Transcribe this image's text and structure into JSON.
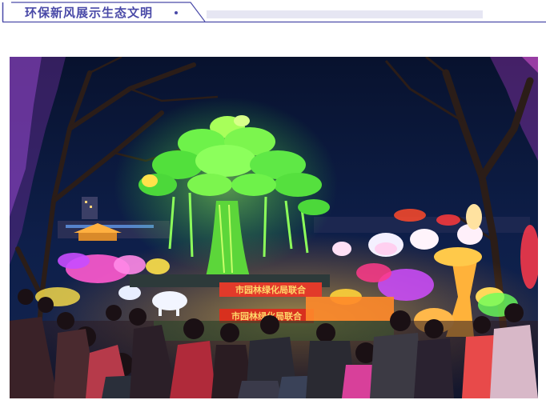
{
  "header": {
    "title": "环保新风展示生态文明",
    "accent_color": "#4a4aa8",
    "bar_color": "#e6e6f3"
  },
  "photo": {
    "subject": "night lantern festival with giant glowing green tree lantern",
    "banner_text_top": "市园林绿化局联合",
    "banner_text_bottom": "市园林绿化局联合"
  }
}
